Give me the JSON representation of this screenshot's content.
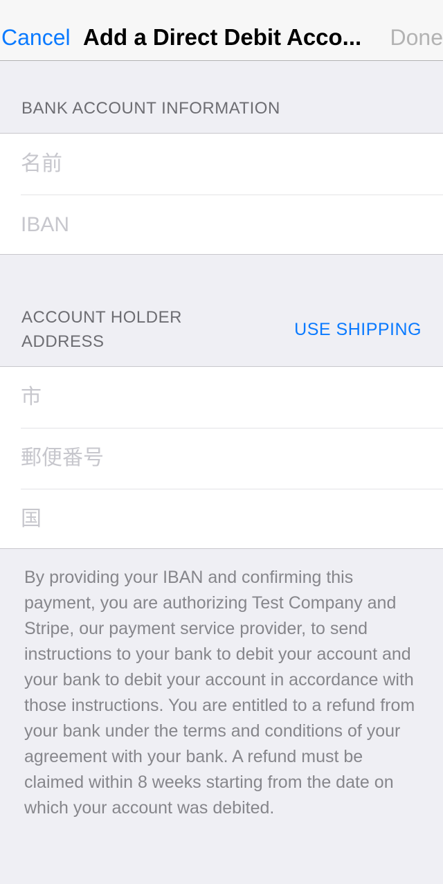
{
  "navbar": {
    "cancel_label": "Cancel",
    "title": "Add a Direct Debit Acco...",
    "done_label": "Done"
  },
  "bank_section": {
    "header": "BANK ACCOUNT INFORMATION",
    "fields": [
      {
        "placeholder": "名前",
        "value": ""
      },
      {
        "placeholder": "IBAN",
        "value": ""
      }
    ]
  },
  "address_section": {
    "header_line1": "ACCOUNT HOLDER",
    "header_line2": "ADDRESS",
    "use_shipping_label": "USE SHIPPING",
    "fields": [
      {
        "placeholder": "市",
        "value": ""
      },
      {
        "placeholder": "郵便番号",
        "value": ""
      },
      {
        "placeholder": "国",
        "value": ""
      }
    ]
  },
  "footer": {
    "mandate_text": "By providing your IBAN and confirming this payment, you are authorizing Test Company and Stripe, our payment service provider, to send instructions to your bank to debit your account and your bank to debit your account in accordance with those instructions. You are entitled to a refund from your bank under the terms and conditions of your agreement with your bank. A refund must be claimed within 8 weeks starting from the date on which your account was debited."
  },
  "colors": {
    "accent": "#0a7aff",
    "disabled": "#b3b3b3",
    "background": "#efeff4"
  }
}
